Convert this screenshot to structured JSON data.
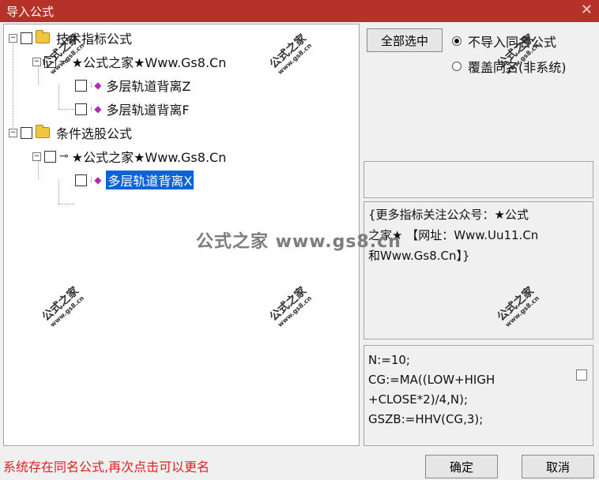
{
  "window": {
    "title": "导入公式",
    "close_glyph": "✕"
  },
  "tree": {
    "technical": {
      "label": "技术指标公式",
      "group": "★公式之家★Www.Gs8.Cn",
      "items": [
        "多层轨道背离Z",
        "多层轨道背离F"
      ]
    },
    "selection": {
      "label": "条件选股公式",
      "group": "★公式之家★Www.Gs8.Cn",
      "items": [
        "多层轨道背离X"
      ]
    }
  },
  "controls": {
    "select_all": "全部选中",
    "radio_no_import": "不导入同名公式",
    "radio_overwrite": "覆盖同名(非系统)"
  },
  "description": {
    "line1": "{更多指标关注公众号：★公式",
    "line2": "之家★ 【网址：Www.Uu11.Cn",
    "line3": "和Www.Gs8.Cn】}"
  },
  "code": {
    "lines": [
      "N:=10;",
      "CG:=MA((LOW+HIGH",
      "+CLOSE*2)/4,N);",
      "GSZB:=HHV(CG,3);"
    ]
  },
  "status": "系统存在同名公式,再次点击可以更名",
  "buttons": {
    "ok": "确定",
    "cancel": "取消"
  },
  "watermark": {
    "main": "公式之家 www.gs8.cn",
    "small_a": "公式之家",
    "small_b": "www.gs8.cn"
  },
  "colors": {
    "titlebar": "#b5322a",
    "selection": "#0a64d6",
    "status": "#e02020",
    "gem": "#b32ab3"
  }
}
